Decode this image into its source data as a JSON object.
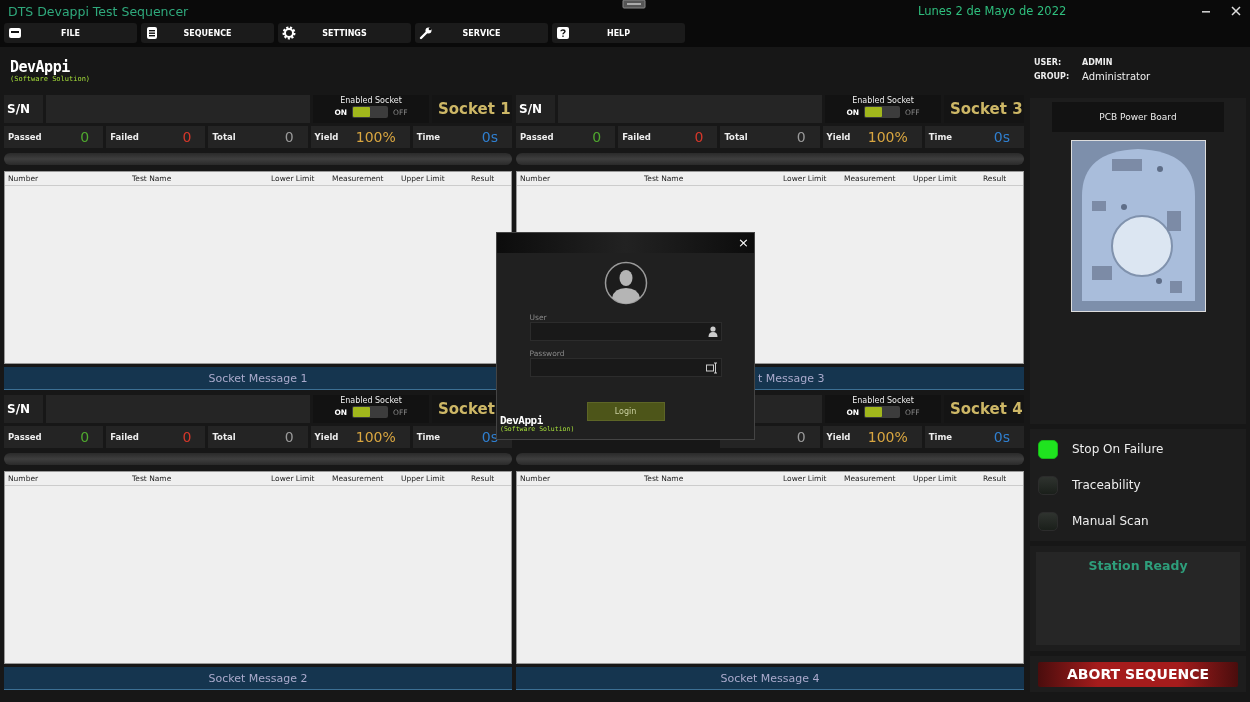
{
  "window": {
    "title": "DTS Devappi Test Sequencer",
    "date": "Lunes 2 de Mayo de 2022"
  },
  "menu": [
    {
      "label": "FILE"
    },
    {
      "label": "SEQUENCE"
    },
    {
      "label": "SETTINGS"
    },
    {
      "label": "SERVICE"
    },
    {
      "label": "HELP"
    }
  ],
  "logo": {
    "name": "DevAppi",
    "tagline": "(Software Solution)"
  },
  "sockets": [
    {
      "title": "Socket 1",
      "level": 0,
      "sn_label": "S/N",
      "enable_label": "Enabled Socket",
      "on_label": "ON",
      "off_label": "OFF",
      "enabled": true,
      "stats": [
        {
          "kind": "passed",
          "label": "Passed",
          "value": "0"
        },
        {
          "kind": "failed",
          "label": "Failed",
          "value": "0"
        },
        {
          "kind": "total",
          "label": "Total",
          "value": "0"
        },
        {
          "kind": "yield",
          "label": "Yield",
          "value": "100%"
        },
        {
          "kind": "time",
          "label": "Time",
          "value": "0s"
        }
      ],
      "columns": [
        "Number",
        "Test Name",
        "Lower Limit",
        "Measurement",
        "Upper Limit",
        "Result"
      ],
      "message": "Socket Message 1"
    },
    {
      "title": "Socket 3",
      "level": 0,
      "sn_label": "S/N",
      "enable_label": "Enabled Socket",
      "on_label": "ON",
      "off_label": "OFF",
      "enabled": true,
      "stats": [
        {
          "kind": "passed",
          "label": "Passed",
          "value": "0"
        },
        {
          "kind": "failed",
          "label": "Failed",
          "value": "0"
        },
        {
          "kind": "total",
          "label": "Total",
          "value": "0"
        },
        {
          "kind": "yield",
          "label": "Yield",
          "value": "100%"
        },
        {
          "kind": "time",
          "label": "Time",
          "value": "0s"
        }
      ],
      "columns": [
        "Number",
        "Test Name",
        "Lower Limit",
        "Measurement",
        "Upper Limit",
        "Result"
      ],
      "message": "t Message 3"
    },
    {
      "title": "Socket",
      "level": 0,
      "sn_label": "S/N",
      "enable_label": "Enabled Socket",
      "on_label": "ON",
      "off_label": "OFF",
      "enabled": true,
      "stats": [
        {
          "kind": "passed",
          "label": "Passed",
          "value": "0"
        },
        {
          "kind": "failed",
          "label": "Failed",
          "value": "0"
        },
        {
          "kind": "total",
          "label": "Total",
          "value": "0"
        },
        {
          "kind": "yield",
          "label": "Yield",
          "value": "100%"
        },
        {
          "kind": "time",
          "label": "Time",
          "value": "0s"
        }
      ],
      "columns": [
        "Number",
        "Test Name",
        "Lower Limit",
        "Measurement",
        "Upper Limit",
        "Result"
      ],
      "message": "Socket Message 2"
    },
    {
      "title": "Socket 4",
      "level": 0,
      "enable_label": "Enabled Socket",
      "on_label": "ON",
      "off_label": "OFF",
      "enabled": true,
      "stats": [
        {
          "kind": "total",
          "value": "0"
        },
        {
          "kind": "yield",
          "label": "Yield",
          "value": "100%"
        },
        {
          "kind": "time",
          "label": "Time",
          "value": "0s"
        }
      ],
      "columns": [
        "Number",
        "Test Name",
        "Lower Limit",
        "Measurement",
        "Upper Limit",
        "Result"
      ],
      "message": "Socket Message 4"
    }
  ],
  "user": {
    "user_label": "USER:",
    "user": "ADMIN",
    "group_label": "GROUP:",
    "group": "Administrator"
  },
  "product": {
    "name": "PCB Power Board"
  },
  "options": [
    {
      "label": "Stop On Failure",
      "checked": true
    },
    {
      "label": "Traceability",
      "checked": false
    },
    {
      "label": "Manual Scan",
      "checked": false
    }
  ],
  "status": "Station Ready",
  "abort": "ABORT SEQUENCE",
  "login": {
    "close": "×",
    "user_label": "User",
    "password_label": "Password",
    "button": "Login",
    "logo": {
      "name": "DevAppi",
      "tagline": "(Software Solution)"
    }
  }
}
